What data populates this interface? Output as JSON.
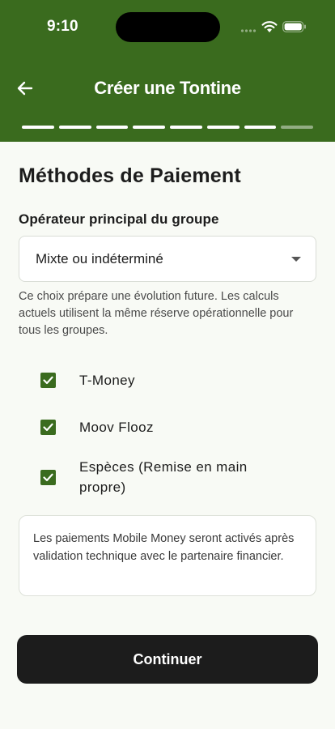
{
  "status_bar": {
    "time": "9:10"
  },
  "header": {
    "title": "Créer une Tontine",
    "back_icon": "arrow-left-icon",
    "progress": {
      "total_steps": 8,
      "current_step": 7
    }
  },
  "main": {
    "section_title": "Méthodes de Paiement",
    "operator": {
      "label": "Opérateur principal du groupe",
      "selected_value": "Mixte ou indéterminé"
    },
    "help_text": "Ce choix prépare une évolution future. Les calculs actuels utilisent la même réserve opérationnelle pour tous les groupes.",
    "payment_methods": [
      {
        "label": "T-Money",
        "checked": true
      },
      {
        "label": "Moov Flooz",
        "checked": true
      },
      {
        "label": "Espèces (Remise en main propre)",
        "checked": true
      }
    ],
    "info_text": "Les paiements Mobile Money seront activés après validation technique avec le partenaire financier.",
    "continue_label": "Continuer"
  },
  "colors": {
    "brand_green": "#3a6b1e",
    "button_dark": "#1c1c1c",
    "background": "#f8faf5"
  }
}
